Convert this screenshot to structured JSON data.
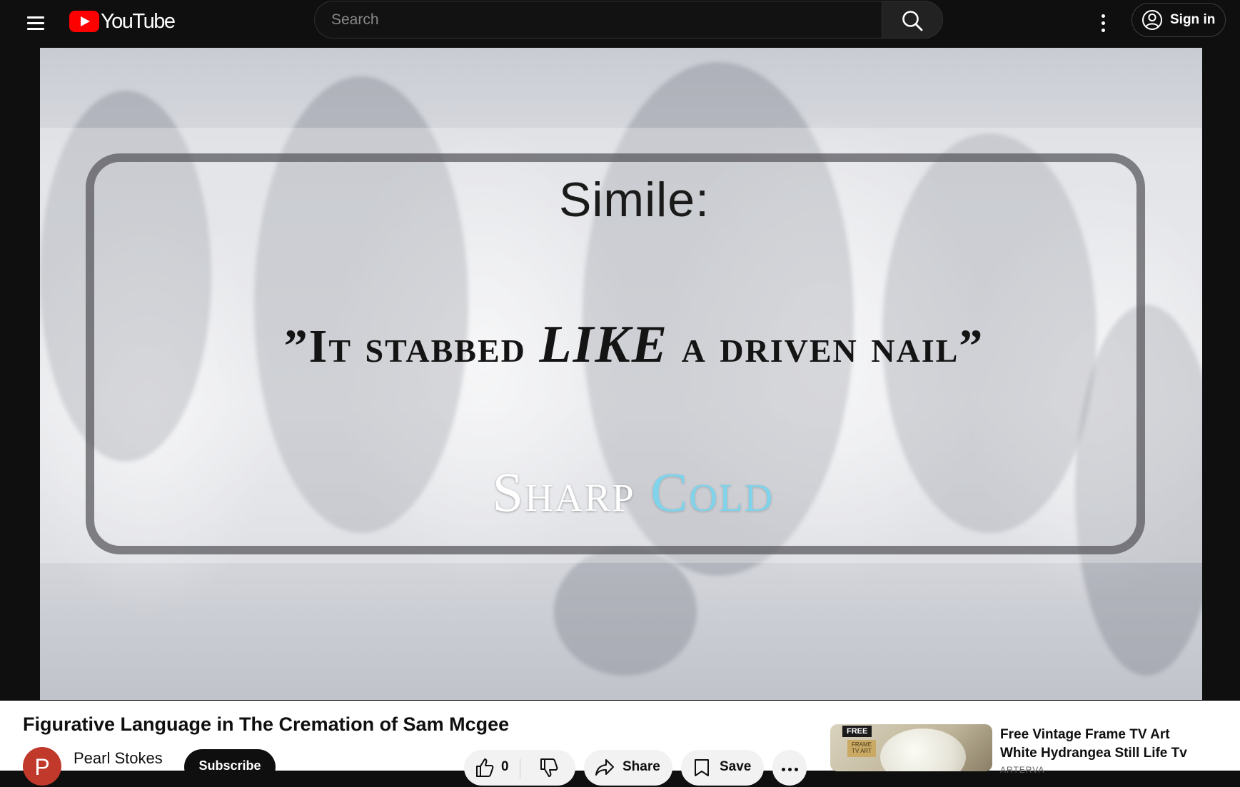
{
  "header": {
    "logo_text": "YouTube",
    "search_placeholder": "Search",
    "signin_label": "Sign in"
  },
  "video": {
    "slide_title": "Simile:",
    "quote_open": "”It stabbed ",
    "quote_like": "LIKE",
    "quote_close": " a driven nail”",
    "sub_sharp": "Sharp ",
    "sub_cold": "Cold"
  },
  "details": {
    "title": "Figurative Language in The Cremation of Sam Mcgee",
    "channel_initial": "P",
    "channel_name": "Pearl Stokes",
    "subscribe_label": "Subscribe",
    "like_count": "0",
    "share_label": "Share",
    "save_label": "Save"
  },
  "ad": {
    "badge": "FREE",
    "tag": "FRAME TV ART",
    "title": "Free Vintage Frame TV Art White Hydrangea Still Life Tv ...",
    "source": "ARTERVA"
  },
  "colors": {
    "accent": "#ff0000",
    "cold_text": "#7fd3ea",
    "background": "#0f0f0f"
  }
}
